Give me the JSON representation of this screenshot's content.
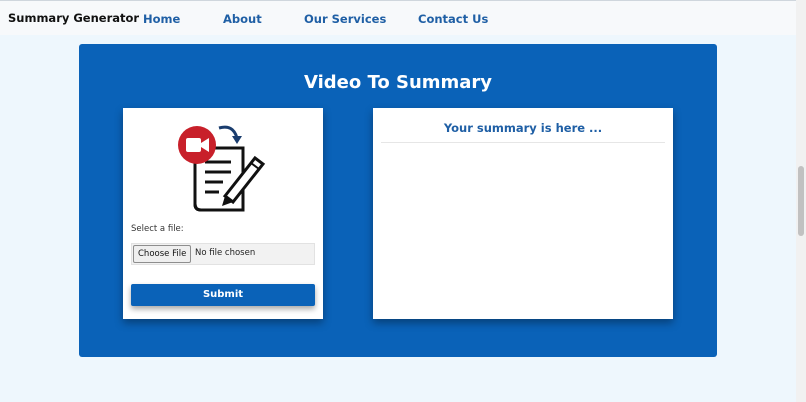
{
  "navbar": {
    "brand": "Summary Generator",
    "links": [
      {
        "label": "Home"
      },
      {
        "label": "About"
      },
      {
        "label": "Our Services"
      },
      {
        "label": "Contact Us"
      }
    ]
  },
  "main": {
    "title": "Video To Summary",
    "upload": {
      "icon": "video-document-edit-icon",
      "file_label": "Select a file:",
      "choose_button": "Choose File",
      "file_status": "No file chosen",
      "submit_label": "Submit"
    },
    "summary": {
      "heading": "Your summary is here ...",
      "content": ""
    }
  },
  "colors": {
    "panel_blue": "#0a62b8",
    "link_blue": "#1f5fa5",
    "page_background": "#eef7fd",
    "icon_red": "#c8202a"
  }
}
